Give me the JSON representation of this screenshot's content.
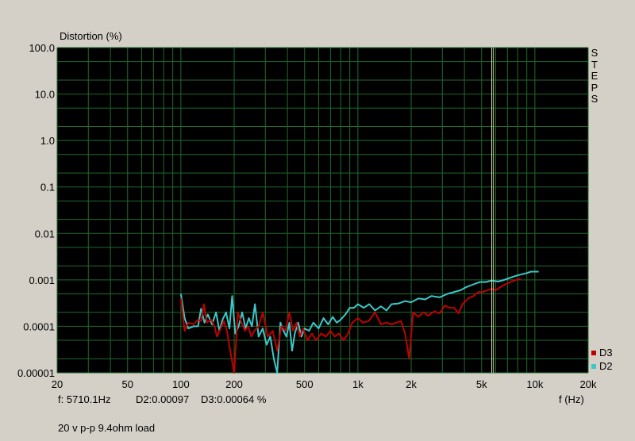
{
  "chart_data": {
    "type": "line",
    "ylabel": "Distortion (%)",
    "xlabel": "f (Hz)",
    "x_scale": "log",
    "y_scale": "log",
    "xlim": [
      20,
      20000
    ],
    "ylim": [
      1e-05,
      100
    ],
    "x_ticks": [
      20,
      50,
      100,
      200,
      500,
      1000,
      2000,
      5000,
      10000,
      20000
    ],
    "x_tick_labels": [
      "20",
      "50",
      "100",
      "200",
      "500",
      "1k",
      "2k",
      "5k",
      "10k",
      "20k"
    ],
    "y_ticks": [
      1e-05,
      0.0001,
      0.001,
      0.01,
      0.1,
      1,
      10,
      100
    ],
    "y_tick_labels": [
      "0.00001",
      "0.0001",
      "0.001",
      "0.01",
      "0.1",
      "1.0",
      "10.0",
      "100.0"
    ],
    "grid": true,
    "legend_position": "right-bottom",
    "cursor_x": 5710.1,
    "series": [
      {
        "name": "D3",
        "color": "#c00000",
        "points": [
          [
            100,
            0.0004
          ],
          [
            105,
            8e-05
          ],
          [
            110,
            0.00012
          ],
          [
            118,
            0.00011
          ],
          [
            125,
            0.00014
          ],
          [
            130,
            0.00013
          ],
          [
            135,
            0.0003
          ],
          [
            140,
            0.00012
          ],
          [
            148,
            0.00014
          ],
          [
            155,
            0.0001
          ],
          [
            160,
            6e-05
          ],
          [
            168,
            9e-05
          ],
          [
            175,
            0.00013
          ],
          [
            182,
            8e-05
          ],
          [
            190,
            3e-05
          ],
          [
            200,
            1e-05
          ],
          [
            210,
            0.0002
          ],
          [
            220,
            0.00012
          ],
          [
            230,
            8e-05
          ],
          [
            240,
            0.0001
          ],
          [
            250,
            6e-05
          ],
          [
            260,
            8e-05
          ],
          [
            275,
            0.0001
          ],
          [
            290,
            0.0002
          ],
          [
            310,
            6e-05
          ],
          [
            330,
            8e-05
          ],
          [
            350,
            3e-05
          ],
          [
            370,
            0.0001
          ],
          [
            390,
            8e-05
          ],
          [
            410,
            0.0002
          ],
          [
            430,
            8e-05
          ],
          [
            450,
            0.00012
          ],
          [
            470,
            6e-05
          ],
          [
            490,
            9e-05
          ],
          [
            520,
            5e-05
          ],
          [
            550,
            7e-05
          ],
          [
            580,
            5e-05
          ],
          [
            620,
            7e-05
          ],
          [
            660,
            6e-05
          ],
          [
            700,
            8e-05
          ],
          [
            740,
            6e-05
          ],
          [
            780,
            7e-05
          ],
          [
            830,
            5e-05
          ],
          [
            880,
            7e-05
          ],
          [
            930,
            0.00012
          ],
          [
            1000,
            0.00015
          ],
          [
            1070,
            0.00012
          ],
          [
            1150,
            0.00013
          ],
          [
            1250,
            0.0002
          ],
          [
            1350,
            0.00011
          ],
          [
            1450,
            0.00012
          ],
          [
            1550,
            0.00011
          ],
          [
            1650,
            0.00012
          ],
          [
            1750,
            0.00013
          ],
          [
            1850,
            7e-05
          ],
          [
            1950,
            2e-05
          ],
          [
            2050,
            0.0002
          ],
          [
            2200,
            0.00016
          ],
          [
            2350,
            0.0002
          ],
          [
            2500,
            0.00017
          ],
          [
            2700,
            0.00021
          ],
          [
            2900,
            0.00019
          ],
          [
            3100,
            0.00028
          ],
          [
            3300,
            0.00025
          ],
          [
            3500,
            0.00025
          ],
          [
            3700,
            0.00019
          ],
          [
            3900,
            0.0003
          ],
          [
            4200,
            0.0004
          ],
          [
            4500,
            0.00045
          ],
          [
            4800,
            0.00055
          ],
          [
            5100,
            0.00055
          ],
          [
            5400,
            0.0006
          ],
          [
            5710,
            0.00064
          ],
          [
            6000,
            0.0006
          ],
          [
            6400,
            0.0007
          ],
          [
            6800,
            0.0008
          ],
          [
            7300,
            0.0009
          ],
          [
            7800,
            0.001
          ],
          [
            8300,
            0.00105
          ]
        ]
      },
      {
        "name": "D2",
        "color": "#3cc8c8",
        "points": [
          [
            100,
            0.0005
          ],
          [
            105,
            0.00015
          ],
          [
            110,
            9e-05
          ],
          [
            118,
            0.0001
          ],
          [
            125,
            0.0001
          ],
          [
            130,
            0.00024
          ],
          [
            136,
            0.00012
          ],
          [
            142,
            0.00018
          ],
          [
            150,
            0.00011
          ],
          [
            158,
            0.0002
          ],
          [
            165,
            8e-05
          ],
          [
            172,
            0.00014
          ],
          [
            180,
            0.0002
          ],
          [
            188,
            9e-05
          ],
          [
            195,
            0.00045
          ],
          [
            203,
            7e-05
          ],
          [
            212,
            0.0001
          ],
          [
            222,
            0.0002
          ],
          [
            232,
            9e-05
          ],
          [
            242,
            0.00015
          ],
          [
            252,
            0.0001
          ],
          [
            262,
            0.0003
          ],
          [
            275,
            6e-05
          ],
          [
            290,
            9e-05
          ],
          [
            305,
            4e-05
          ],
          [
            320,
            6e-05
          ],
          [
            335,
            2e-05
          ],
          [
            350,
            1e-05
          ],
          [
            365,
            0.00012
          ],
          [
            380,
            8e-05
          ],
          [
            395,
            6e-05
          ],
          [
            410,
            0.00012
          ],
          [
            425,
            3e-05
          ],
          [
            440,
            7e-05
          ],
          [
            460,
            0.00012
          ],
          [
            480,
            6e-05
          ],
          [
            500,
            9e-05
          ],
          [
            530,
            8e-05
          ],
          [
            560,
            0.00012
          ],
          [
            600,
            9e-05
          ],
          [
            640,
            0.00015
          ],
          [
            680,
            0.00011
          ],
          [
            720,
            0.00016
          ],
          [
            760,
            0.00012
          ],
          [
            800,
            0.00014
          ],
          [
            850,
            0.00018
          ],
          [
            900,
            0.00025
          ],
          [
            950,
            0.00025
          ],
          [
            1000,
            0.0003
          ],
          [
            1080,
            0.00025
          ],
          [
            1160,
            0.0003
          ],
          [
            1250,
            0.00022
          ],
          [
            1350,
            0.00027
          ],
          [
            1450,
            0.00022
          ],
          [
            1550,
            0.0003
          ],
          [
            1700,
            0.00031
          ],
          [
            1850,
            0.00035
          ],
          [
            2000,
            0.00033
          ],
          [
            2200,
            0.0004
          ],
          [
            2400,
            0.00038
          ],
          [
            2600,
            0.00045
          ],
          [
            2900,
            0.00042
          ],
          [
            3200,
            0.0005
          ],
          [
            3500,
            0.00055
          ],
          [
            3800,
            0.0006
          ],
          [
            4100,
            0.0007
          ],
          [
            4500,
            0.0008
          ],
          [
            4900,
            0.0009
          ],
          [
            5300,
            0.0009
          ],
          [
            5710,
            0.00097
          ],
          [
            6200,
            0.00092
          ],
          [
            6700,
            0.001
          ],
          [
            7200,
            0.0011
          ],
          [
            7700,
            0.0012
          ],
          [
            8300,
            0.0013
          ],
          [
            9000,
            0.0014
          ],
          [
            9500,
            0.0015
          ],
          [
            10000,
            0.0015
          ],
          [
            10500,
            0.0015
          ]
        ]
      }
    ],
    "steps_label": "STEPS"
  },
  "readout": {
    "frequency": "f:  5710.1Hz",
    "d2": "D2:0.00097",
    "d3": "D3:0.00064 %"
  },
  "note": "20 v p-p 9.4ohm load",
  "legend": [
    {
      "name": "D3",
      "color": "#c00000"
    },
    {
      "name": "D2",
      "color": "#3cc8c8"
    }
  ]
}
